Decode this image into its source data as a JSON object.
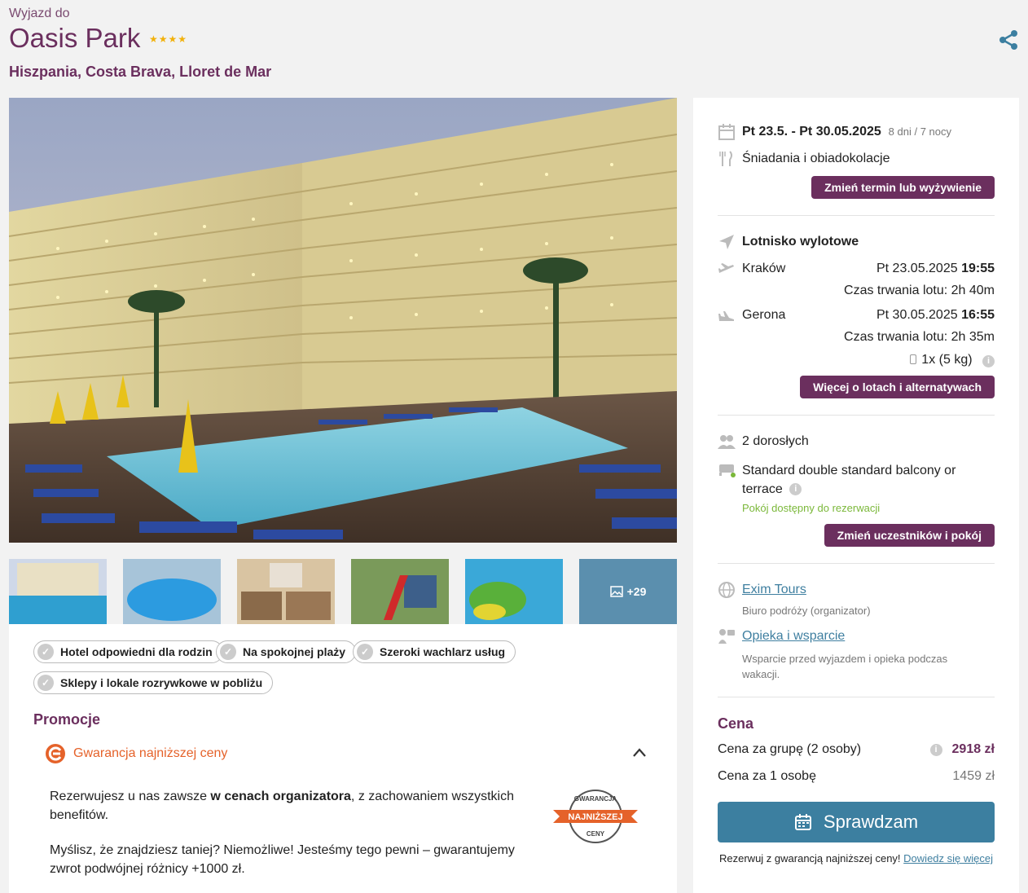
{
  "header": {
    "eyebrow": "Wyjazd do",
    "title": "Oasis Park",
    "stars": "★★★★",
    "location": "Hiszpania, Costa Brava, Lloret de Mar"
  },
  "gallery": {
    "more_label": "+29"
  },
  "tags": [
    "Hotel odpowiedni dla rodzin",
    "Na spokojnej plaży",
    "Szeroki wachlarz usług",
    "Sklepy i lokale rozrywkowe w pobliżu"
  ],
  "promotions": {
    "title": "Promocje",
    "guarantee_label": "Gwarancja najniższej ceny",
    "p1_before": "Rezerwujesz u nas zawsze ",
    "p1_bold": "w cenach organizatora",
    "p1_after": ", z zachowaniem wszystkich benefitów.",
    "p2": "Myślisz, że znajdziesz taniej? Niemożliwe! Jesteśmy tego pewni – gwarantujemy zwrot podwójnej różnicy +1000 zł.",
    "badge_top": "GWARANCJA",
    "badge_mid": "NAJNIŻSZEJ",
    "badge_bottom": "CENY"
  },
  "booking": {
    "dates": "Pt 23.5. - Pt 30.05.2025",
    "duration": "8 dni / 7 nocy",
    "board": "Śniadania i obiadokolacje",
    "change_date_button": "Zmień termin lub wyżywienie",
    "airport_label": "Lotnisko wylotowe",
    "outbound_city": "Kraków",
    "outbound_date": "Pt 23.05.2025",
    "outbound_time": "19:55",
    "outbound_duration": "Czas trwania lotu: 2h 40m",
    "return_city": "Gerona",
    "return_date": "Pt 30.05.2025",
    "return_time": "16:55",
    "return_duration": "Czas trwania lotu: 2h 35m",
    "baggage": "1x (5 kg)",
    "flights_button": "Więcej o lotach i alternatywach",
    "guests": "2 dorosłych",
    "room_line1": "Standard double standard balcony or",
    "room_line2": "terrace",
    "room_status": "Pokój dostępny do rezerwacji",
    "change_room_button": "Zmień uczestników i pokój",
    "organizer_name": "Exim Tours",
    "organizer_desc": "Biuro podróży (organizator)",
    "support_name": "Opieka i wsparcie",
    "support_desc_1": "Wsparcie przed wyjazdem i opieka podczas",
    "support_desc_2": "wakacji.",
    "price_title": "Cena",
    "group_price_label": "Cena za grupę (2 osoby)",
    "group_price": "2918 zł",
    "person_price_label": "Cena za 1 osobę",
    "person_price": "1459 zł",
    "cta_label": "Sprawdzam",
    "footer_text": "Rezerwuj z gwarancją najniższej ceny!",
    "footer_link": "Dowiedz się więcej"
  },
  "colors": {
    "brand": "#6b2f5e",
    "cta": "#3c7fa0",
    "guarantee": "#e5622a",
    "available": "#7bb83a"
  }
}
